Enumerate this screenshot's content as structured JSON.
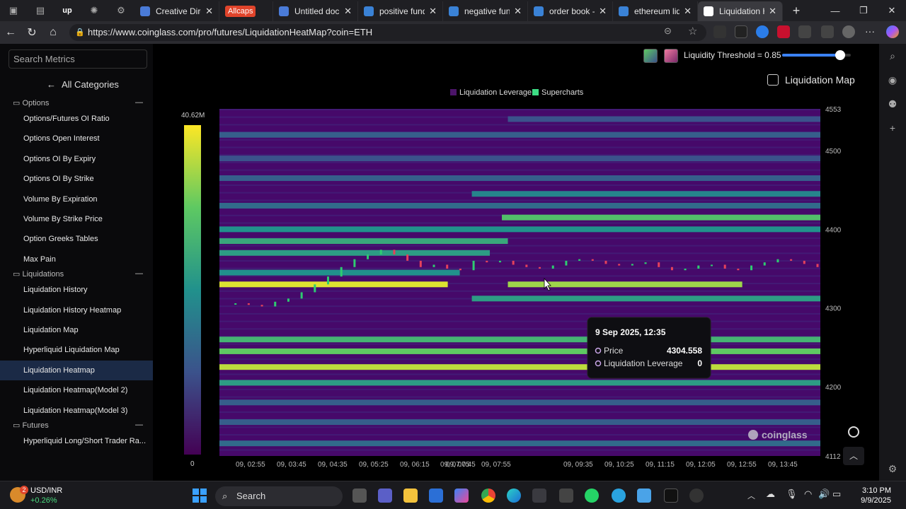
{
  "browser": {
    "tabs": [
      {
        "label": "Creative Directo",
        "color": "#4a7bd8"
      },
      {
        "label": "Allcaps",
        "color": "#e0442b",
        "badge": true
      },
      {
        "label": "Untitled docum",
        "color": "#4a7bd8"
      },
      {
        "label": "positive funding",
        "color": "#3a82d6"
      },
      {
        "label": "negative fundin",
        "color": "#3a82d6"
      },
      {
        "label": "order book - Se",
        "color": "#3a82d6"
      },
      {
        "label": "ethereum liqui",
        "color": "#3a82d6"
      },
      {
        "label": "Liquidation Hea",
        "color": "#ffffff",
        "active": true
      }
    ],
    "url": "https://www.coinglass.com/pro/futures/LiquidationHeatMap?coin=ETH"
  },
  "sidebar": {
    "search_placeholder": "Search Metrics",
    "all_categories": "All Categories",
    "sections": [
      {
        "label": "Options",
        "items": [
          "Options/Futures OI Ratio",
          "Options Open Interest",
          "Options OI By Expiry",
          "Options OI By Strike",
          "Volume By Expiration",
          "Volume By Strike Price",
          "Option Greeks Tables",
          "Max Pain"
        ]
      },
      {
        "label": "Liquidations",
        "items": [
          "Liquidation History",
          "Liquidation History Heatmap",
          "Liquidation Map",
          "Hyperliquid Liquidation Map",
          "Liquidation Heatmap",
          "Liquidation Heatmap(Model 2)",
          "Liquidation Heatmap(Model 3)"
        ]
      },
      {
        "label": "Futures",
        "items": [
          "Hyperliquid Long/Short Trader Ra..."
        ]
      }
    ],
    "selected": "Liquidation Heatmap"
  },
  "controls": {
    "threshold_label": "Liquidity Threshold = 0.85",
    "threshold_value": 0.85,
    "liq_map_label": "Liquidation Map"
  },
  "chart_data": {
    "type": "heatmap",
    "legend": [
      {
        "name": "Liquidation Leverage",
        "color": "#4b1469"
      },
      {
        "name": "Supercharts",
        "color": "#3ddc84"
      }
    ],
    "scale_max_label": "40.62M",
    "scale_min_label": "0",
    "y_ticks": [
      4553,
      4500,
      4400,
      4300,
      4200,
      4112
    ],
    "ylim": [
      4112,
      4553
    ],
    "x_ticks": [
      "09, 02:55",
      "09, 03:45",
      "09, 04:35",
      "09, 05:25",
      "09, 06:15",
      "09, 07:05",
      "09, 07:45",
      "09, 07:55",
      "09, 09:35",
      "09, 10:25",
      "09, 11:15",
      "09, 12:05",
      "09, 12:55",
      "09, 13:45"
    ],
    "bands": [
      {
        "price": 4540,
        "intensity": 0.25,
        "start": 0.48
      },
      {
        "price": 4520,
        "intensity": 0.3,
        "start": 0.0
      },
      {
        "price": 4490,
        "intensity": 0.25,
        "start": 0.0
      },
      {
        "price": 4465,
        "intensity": 0.3,
        "start": 0.0
      },
      {
        "price": 4445,
        "intensity": 0.45,
        "start": 0.42
      },
      {
        "price": 4430,
        "intensity": 0.35,
        "start": 0.0
      },
      {
        "price": 4415,
        "intensity": 0.7,
        "start": 0.47
      },
      {
        "price": 4400,
        "intensity": 0.5,
        "start": 0.0
      },
      {
        "price": 4385,
        "intensity": 0.6,
        "start": 0.0,
        "end": 0.48
      },
      {
        "price": 4370,
        "intensity": 0.55,
        "start": 0.0,
        "end": 0.45
      },
      {
        "price": 4345,
        "intensity": 0.5,
        "start": 0.0,
        "end": 0.4
      },
      {
        "price": 4330,
        "intensity": 0.95,
        "start": 0.0,
        "end": 0.38
      },
      {
        "price": 4330,
        "intensity": 0.85,
        "start": 0.48,
        "end": 0.87
      },
      {
        "price": 4312,
        "intensity": 0.55,
        "start": 0.42
      },
      {
        "price": 4260,
        "intensity": 0.65,
        "start": 0.0
      },
      {
        "price": 4245,
        "intensity": 0.75,
        "start": 0.0
      },
      {
        "price": 4225,
        "intensity": 0.9,
        "start": 0.0
      },
      {
        "price": 4205,
        "intensity": 0.55,
        "start": 0.0
      },
      {
        "price": 4180,
        "intensity": 0.3,
        "start": 0.0
      },
      {
        "price": 4155,
        "intensity": 0.3,
        "start": 0.0
      },
      {
        "price": 4128,
        "intensity": 0.35,
        "start": 0.0
      }
    ],
    "price_path": [
      4305,
      4306,
      4304,
      4302,
      4308,
      4312,
      4320,
      4330,
      4340,
      4352,
      4362,
      4368,
      4374,
      4368,
      4360,
      4352,
      4355,
      4350,
      4348,
      4360,
      4358,
      4360,
      4355,
      4352,
      4350,
      4354,
      4360,
      4362,
      4360,
      4356,
      4354,
      4356,
      4358,
      4352,
      4348,
      4350,
      4354,
      4355,
      4350,
      4348,
      4354,
      4358,
      4362,
      4360,
      4356,
      4352
    ],
    "tooltip": {
      "date": "9 Sep 2025, 12:35",
      "price_label": "Price",
      "price_value": "4304.558",
      "lev_label": "Liquidation Leverage",
      "lev_value": "0"
    },
    "watermark": "coinglass"
  },
  "taskbar": {
    "ticker": "USD/INR",
    "change": "+0.26%",
    "notif": "2",
    "search": "Search",
    "time": "3:10 PM",
    "date": "9/9/2025"
  }
}
